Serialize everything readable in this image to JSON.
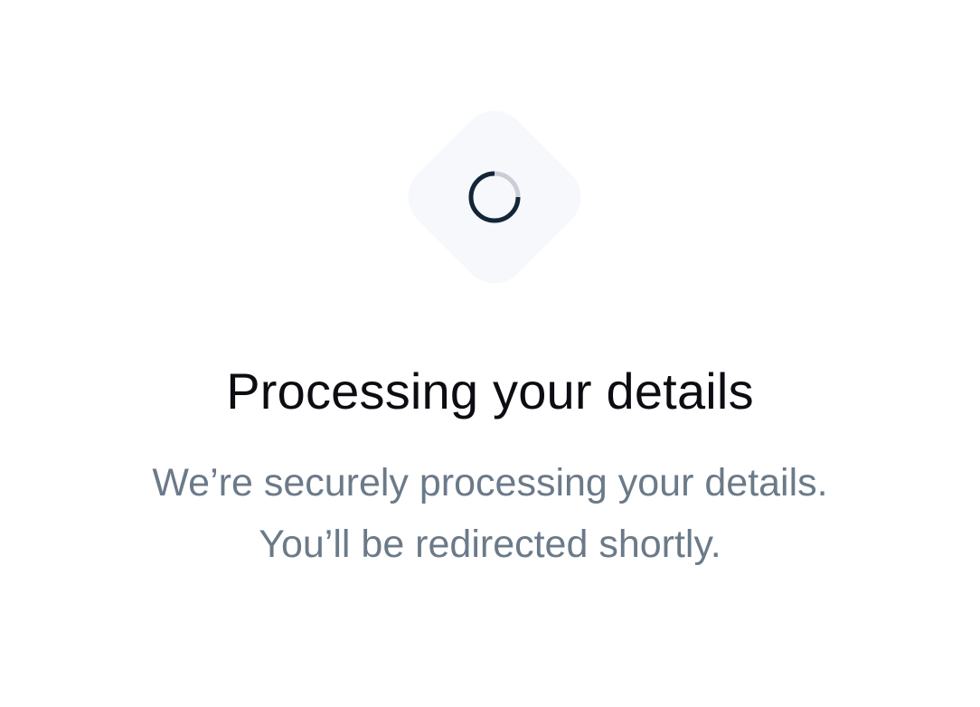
{
  "status": {
    "title": "Processing your details",
    "description_line1": "We’re securely processing your details.",
    "description_line2": "You’ll be redirected shortly."
  },
  "icons": {
    "spinner": "loading-spinner-icon"
  },
  "colors": {
    "tile_background": "#f6f8fb",
    "spinner_active": "#14253a",
    "spinner_track": "#c9ced6",
    "title": "#0b0d12",
    "description": "#6b7a89"
  }
}
